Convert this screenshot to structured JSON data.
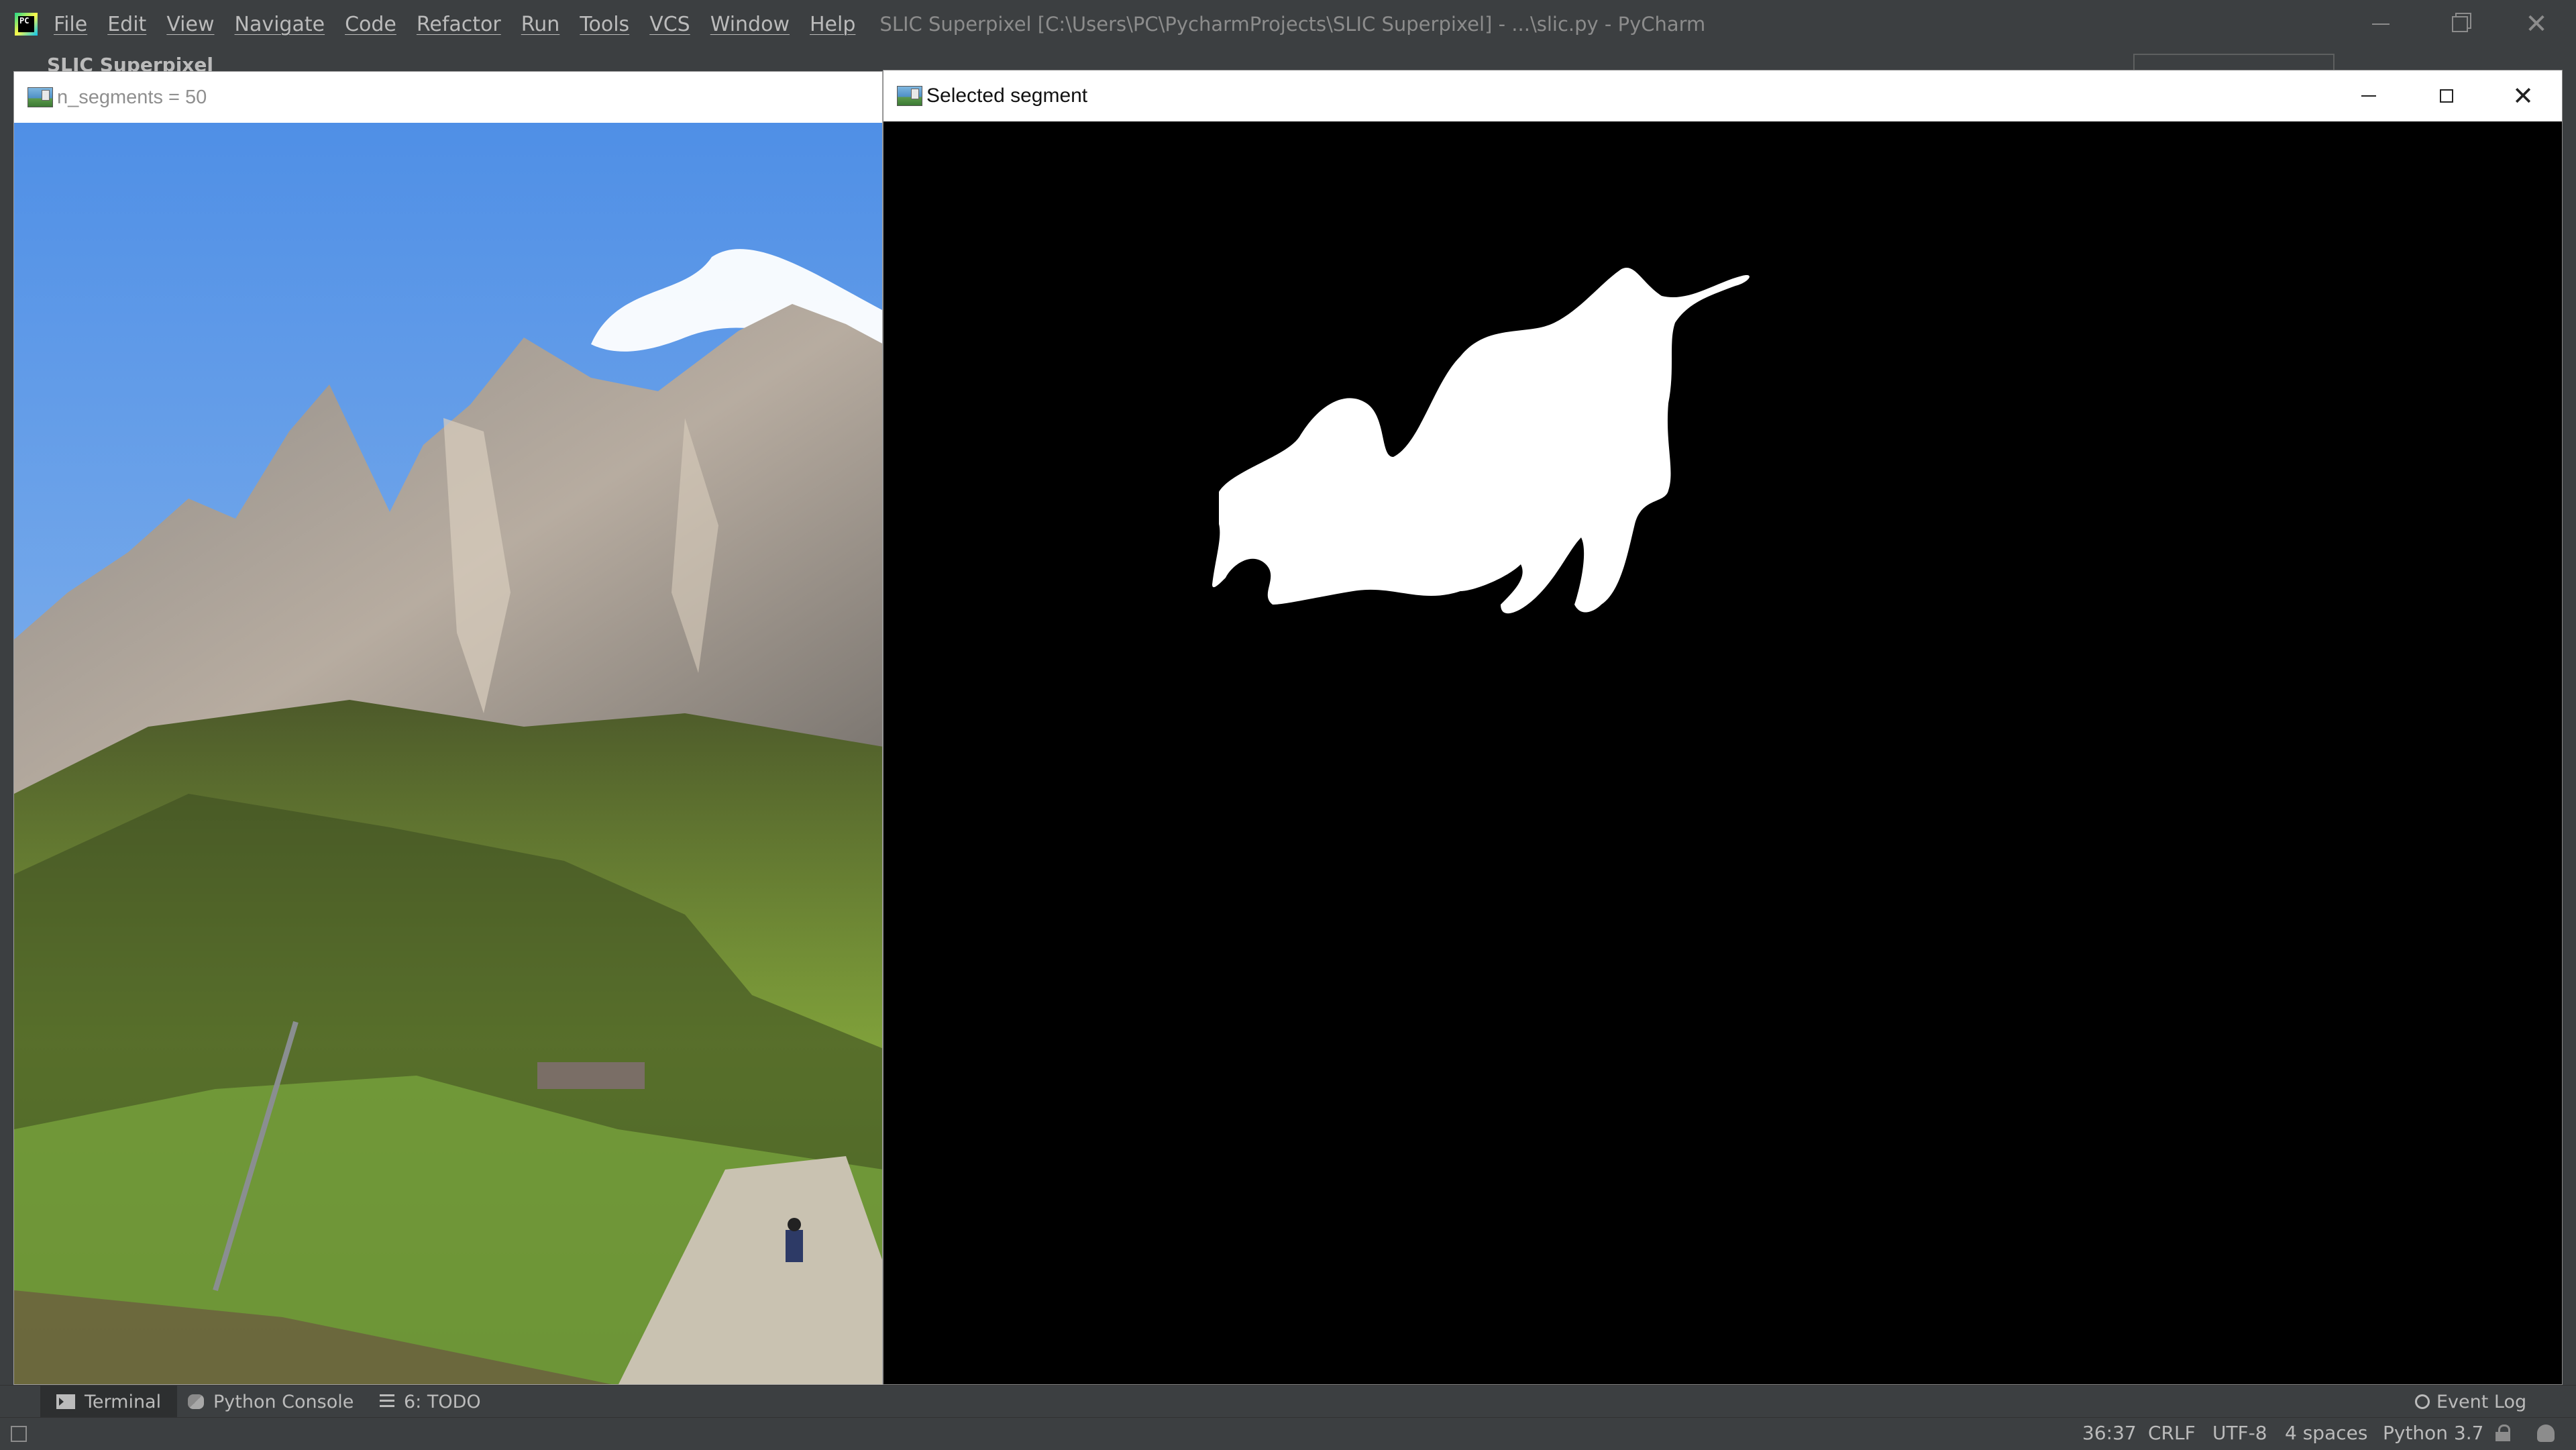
{
  "ide": {
    "menu": [
      "File",
      "Edit",
      "View",
      "Navigate",
      "Code",
      "Refactor",
      "Run",
      "Tools",
      "VCS",
      "Window",
      "Help"
    ],
    "window_title": "SLIC Superpixel [C:\\Users\\PC\\PycharmProjects\\SLIC Superpixel] - ...\\slic.py - PyCharm",
    "logo_text": "PC",
    "breadcrumb_behind": "SLIC Superpixel"
  },
  "left_window": {
    "title": "n_segments = 50"
  },
  "right_window": {
    "title": "Selected segment"
  },
  "bottom_tabs": {
    "terminal": "Terminal",
    "python_console": "Python Console",
    "todo": "6: TODO",
    "event_log": "Event Log"
  },
  "status_bar": {
    "position": "36:37",
    "line_separator": "CRLF",
    "encoding": "UTF-8",
    "indent": "4 spaces",
    "interpreter": "Python 3.7"
  },
  "icons": {
    "terminal": "terminal-icon",
    "python_console": "python-console-icon",
    "todo": "todo-list-icon",
    "event_log": "event-log-icon",
    "lock": "lock-icon"
  },
  "colors": {
    "ide_bg": "#3c3f41",
    "mask_bg": "#000000",
    "mask_fg": "#ffffff"
  }
}
